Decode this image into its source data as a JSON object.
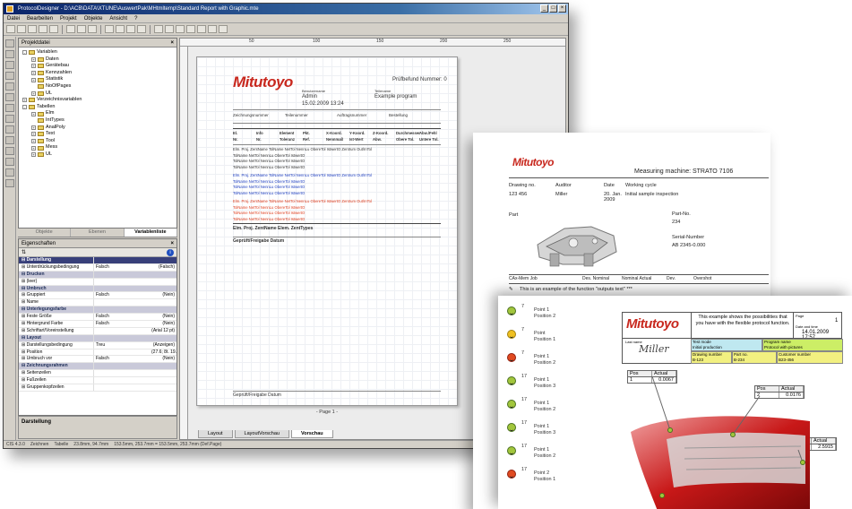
{
  "window": {
    "title": "ProtocolDesigner - D:\\ACB\\DATA\\XTUNE\\AuswertPak\\MHtmltemp\\Standard Report with Graphic.mte",
    "menu": [
      "Datei",
      "Bearbeiten",
      "Projekt",
      "Objekte",
      "Ansicht",
      "?"
    ]
  },
  "explorer": {
    "title": "Projektdatei",
    "tree": [
      {
        "label": "Variablen",
        "depth": 0,
        "sign": "-"
      },
      {
        "label": "Daten",
        "depth": 1,
        "sign": "+"
      },
      {
        "label": "Gerätebau",
        "depth": 1,
        "sign": "+"
      },
      {
        "label": "Kennzahlen",
        "depth": 1,
        "sign": "+"
      },
      {
        "label": "Statistik",
        "depth": 1,
        "sign": "+"
      },
      {
        "label": "NoOfPages",
        "depth": 1,
        "sign": ""
      },
      {
        "label": "UL",
        "depth": 1,
        "sign": "+"
      },
      {
        "label": "Verzeichnisvariablen",
        "depth": 0,
        "sign": "+"
      },
      {
        "label": "Tabellen",
        "depth": 0,
        "sign": "-"
      },
      {
        "label": "Elm",
        "depth": 1,
        "sign": "+"
      },
      {
        "label": "IntTypes",
        "depth": 1,
        "sign": ""
      },
      {
        "label": "AnalPoly",
        "depth": 1,
        "sign": "+"
      },
      {
        "label": "Text",
        "depth": 1,
        "sign": "+"
      },
      {
        "label": "Tool",
        "depth": 1,
        "sign": "+"
      },
      {
        "label": "Mess",
        "depth": 1,
        "sign": "+"
      },
      {
        "label": "UL",
        "depth": 1,
        "sign": "+"
      }
    ],
    "tabs": [
      "Objekte",
      "Ebenen",
      "Variablenliste"
    ]
  },
  "properties": {
    "title": "Eigenschaften",
    "rows": [
      {
        "k": "Darstellung",
        "v": "",
        "v2": "",
        "type": "sel"
      },
      {
        "k": "Unterdrückungsbedingung",
        "v": "Falsch",
        "v2": "(Falsch)",
        "type": ""
      },
      {
        "k": "Drucken",
        "v": "",
        "v2": "",
        "type": "cat"
      },
      {
        "k": "(leer)",
        "v": "",
        "v2": "",
        "type": ""
      },
      {
        "k": "Umbruch",
        "v": "",
        "v2": "",
        "type": "cat"
      },
      {
        "k": "Gruppiert",
        "v": "Falsch",
        "v2": "(Nein)",
        "type": ""
      },
      {
        "k": "Name",
        "v": "",
        "v2": "",
        "type": ""
      },
      {
        "k": "Unterlegungsfarbe",
        "v": "",
        "v2": "",
        "type": "cat"
      },
      {
        "k": "Feste Größe",
        "v": "Falsch",
        "v2": "(Nein)",
        "type": ""
      },
      {
        "k": "Hintergrund Farbe",
        "v": "Falsch",
        "v2": "(Nein)",
        "type": ""
      },
      {
        "k": "Schriftart/Voreinstellung",
        "v": "",
        "v2": "(Arial 12 pt)",
        "type": ""
      },
      {
        "k": "Layout",
        "v": "",
        "v2": "",
        "type": "cat"
      },
      {
        "k": "Darstellungsbedingung",
        "v": "Treu",
        "v2": "(Anzeigen)",
        "type": ""
      },
      {
        "k": "Position",
        "v": "",
        "v2": "(27.6; 8t. 19.0 ; 257.7 mm)",
        "type": ""
      },
      {
        "k": "Umbruch vor",
        "v": "Falsch",
        "v2": "(Nein)",
        "type": ""
      },
      {
        "k": "Zeichnungsrahmen",
        "v": "",
        "v2": "",
        "type": "cat"
      },
      {
        "k": "Seitenzeilen",
        "v": "",
        "v2": "",
        "type": ""
      },
      {
        "k": "Fußzeilen",
        "v": "",
        "v2": "",
        "type": ""
      },
      {
        "k": "Gruppenkopfzeilen",
        "v": "",
        "v2": "",
        "type": ""
      }
    ],
    "description": "Darstellung"
  },
  "ruler": [
    "50",
    "100",
    "150",
    "200",
    "250"
  ],
  "report": {
    "logo": "Mitutoyo",
    "protocol_no": "Prüfbefund Nummer: 0",
    "user_label": "Benutzername",
    "user_value": "Admin",
    "datetime": "15.02.2009 13:24",
    "program_label": "Teilename",
    "program_value": "Example program",
    "header_cols": [
      "Zeichnungsnummer",
      "Teilenummer",
      "Auftragsnummer",
      "Bestellung"
    ],
    "table_head1": [
      "El.",
      "Info",
      "Element",
      "Pkt.",
      "X-Koord.",
      "Y-Koord.",
      "Z-Koord.",
      "Durchmesser",
      "Abw./Fehl"
    ],
    "table_head2": [
      "Nr.",
      "Nr.",
      "Toleranz",
      "Ref.",
      "Nennmaß",
      "Ist-Wert",
      "Abw.",
      "Obere Tol.",
      "Untere Tol."
    ],
    "rows": [
      {
        "c": "#333",
        "t": "Elm. Proj. ZentName  TolName  NetTol  NennLu  ObereTol  IstwertO  Zentrum  Out/InTol"
      },
      {
        "c": "#2040c0",
        "t": "Elm. Proj. ZentName  TolName  NetTol  NennLu  ObereTol  IstwertO  Zentrum  Out/InTol"
      },
      {
        "c": "#e04020",
        "t": "Elm. Proj. ZentName  TolName  NetTol  NennLu  ObereTol  IstwertO  Zentrum  Out/InTol"
      }
    ],
    "footer_left": "Geprüft/Freigabe Datum",
    "page_label": "- Page 1 -"
  },
  "doc_tabs": [
    "Layout",
    "LayoutVorschau",
    "Vorschau"
  ],
  "status": [
    "CIS 4.3.0",
    "Zeichnen",
    "Tabelle",
    "23.8mm, 94.7mm",
    "153.5mm, 253.7mm = 153.5mm, 253.7mm (Def.Page)"
  ],
  "page2": {
    "logo": "Mitutoyo",
    "machine": "Measuring machine: STRATO 7106",
    "labels": [
      "Drawing no.",
      "Auditor",
      "Date",
      "Working cycle"
    ],
    "values": [
      "123 456",
      "Miller",
      "20. Jan. 2009",
      "Initial sample inspection"
    ],
    "part_label": "Part",
    "part_no_label": "Part-No.",
    "part_no": "234",
    "serial_label": "Serial-Number",
    "serial": "AB 2345-0.000",
    "table_head": [
      "CAx-Mem Job",
      "",
      "Des. Nominal",
      "Nominal Actual",
      "Dev.",
      "Overshot"
    ],
    "func_text": "This is an example of the function \"outputs text\"  ***"
  },
  "page3": {
    "logo": "Mitutoyo",
    "desc": "This example shows the possibilities that you have with the flexible protocol function.",
    "page_label": "Page",
    "page_no": "1",
    "date_label": "Date and time",
    "date": "14.01.2009 17:57",
    "signature": "Miller",
    "boxes": [
      {
        "k": "Test mode",
        "v": "Initial production",
        "c": "#bfe8f0"
      },
      {
        "k": "Program name",
        "v": "Protocol with pictures",
        "c": "#ccee66"
      },
      {
        "k": "Drawing number",
        "v": "B-123",
        "c": "#f2f080"
      },
      {
        "k": "Part no.",
        "v": "B-234",
        "c": "#f2f080"
      },
      {
        "k": "Customer number",
        "v": "B23-456",
        "c": "#f2f080"
      }
    ],
    "points": [
      {
        "n": "7",
        "l": "Point 1\nPosition 2",
        "c": "g"
      },
      {
        "n": "7",
        "l": "Point\nPosition 1",
        "c": "y"
      },
      {
        "n": "7",
        "l": "Point 1\nPosition 2",
        "c": "r"
      },
      {
        "n": "17",
        "l": "Point 1\nPosition 3",
        "c": "g"
      },
      {
        "n": "17",
        "l": "Point 1\nPosition 2",
        "c": "g"
      },
      {
        "n": "17",
        "l": "Point 1\nPosition 3",
        "c": "g"
      },
      {
        "n": "17",
        "l": "Point 1\nPosition 2",
        "c": "g"
      },
      {
        "n": "17",
        "l": "Point 2\nPosition 1",
        "c": "r"
      }
    ],
    "callouts": [
      {
        "pos": "1",
        "actual": "0.0067"
      },
      {
        "pos": "2",
        "actual": "0.0176"
      },
      {
        "pos": "3",
        "actual": "2.5915"
      }
    ],
    "callout_head": [
      "Pos",
      "Actual"
    ]
  }
}
